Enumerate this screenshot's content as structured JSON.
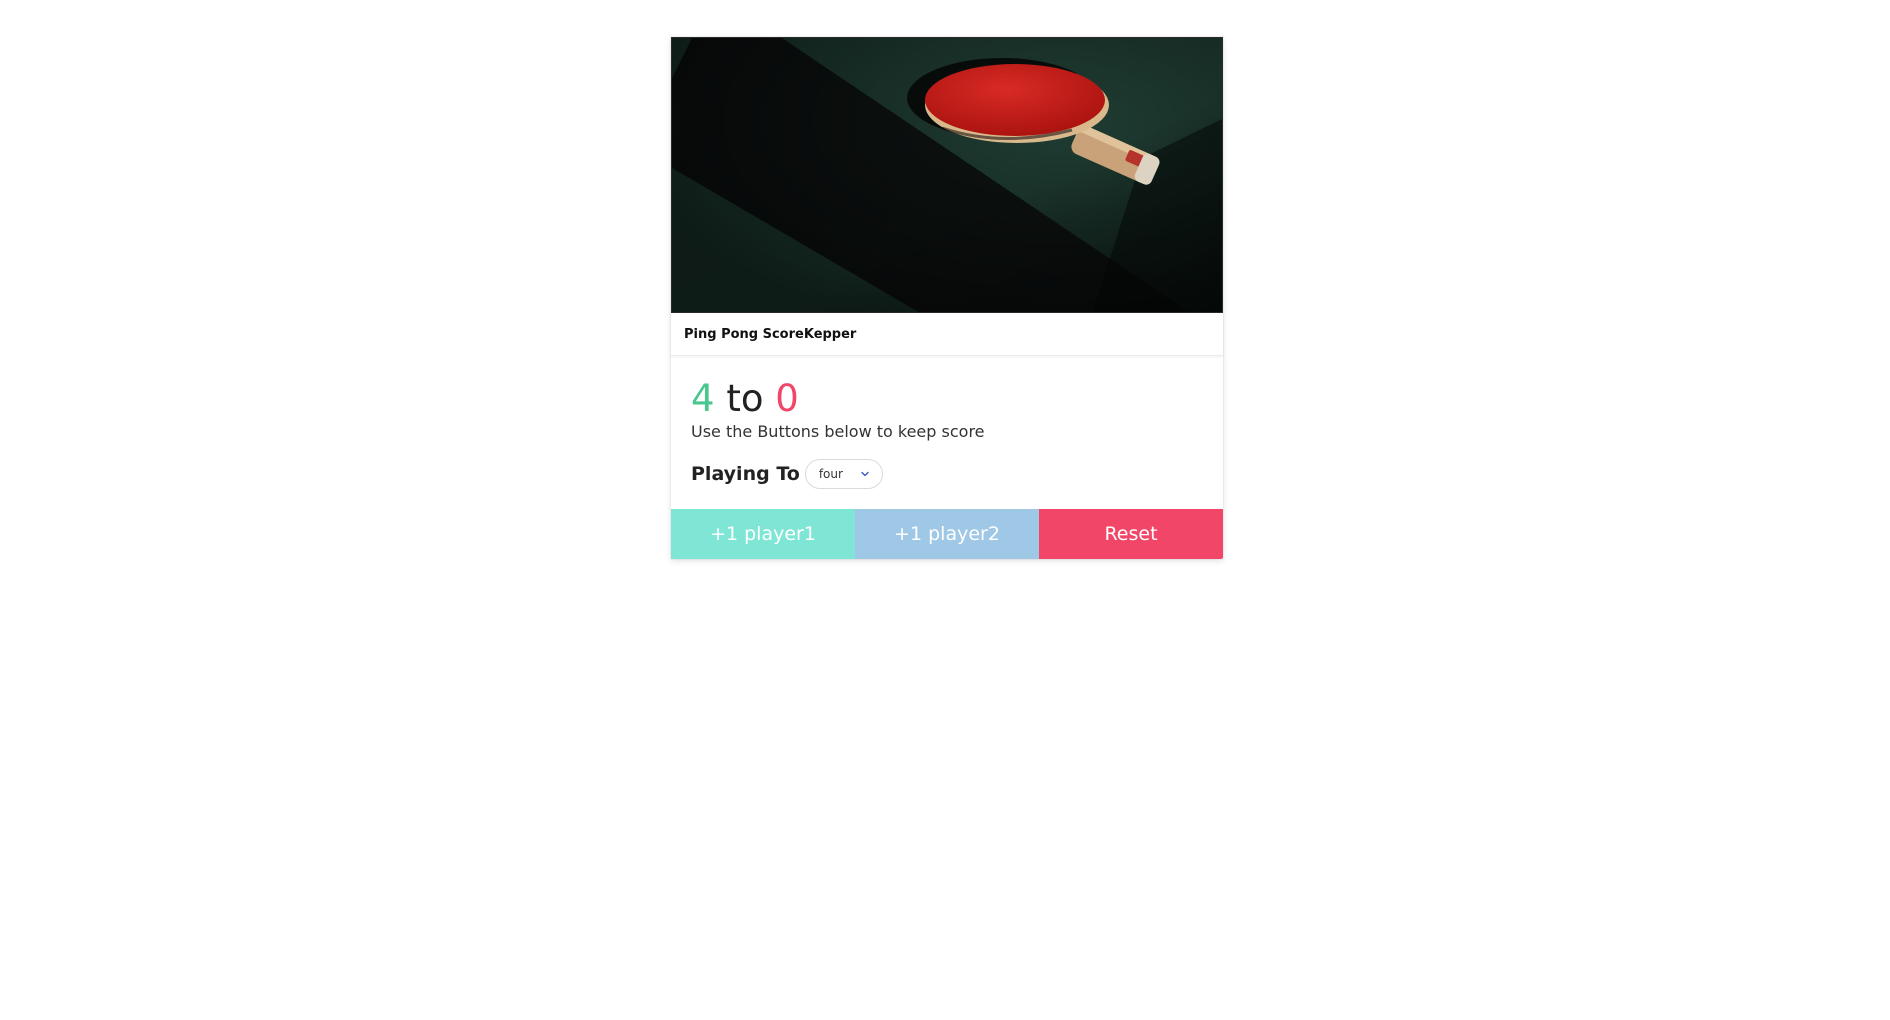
{
  "card": {
    "title": "Ping Pong ScoreKepper"
  },
  "score": {
    "player1": "4",
    "separator": "to",
    "player2": "0"
  },
  "subtitle": "Use the Buttons below to keep score",
  "playing_to": {
    "label": "Playing To",
    "selected": "four"
  },
  "buttons": {
    "player1": "+1 player1",
    "player2": "+1 player2",
    "reset": "Reset"
  },
  "colors": {
    "player1": "#48c78e",
    "player2": "#f14668",
    "btn_player1": "#7fe6d5",
    "btn_player2": "#9fc7e6",
    "btn_reset": "#f14668"
  },
  "icons": {
    "select_arrow": "chevron-down-icon",
    "hero_image": "ping-pong-paddle-image"
  }
}
